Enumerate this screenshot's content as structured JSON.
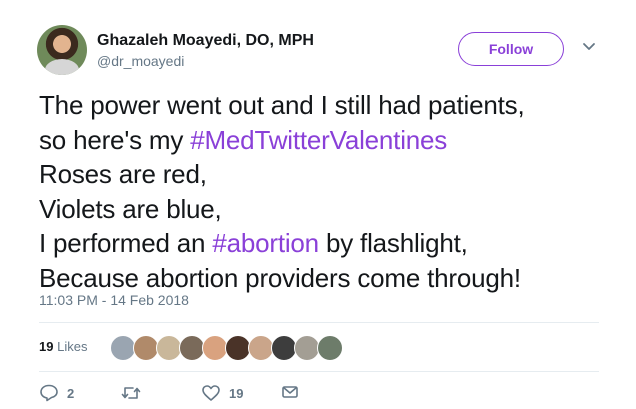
{
  "author": {
    "display_name": "Ghazaleh Moayedi, DO, MPH",
    "handle": "@dr_moayedi",
    "avatar_icon": "avatar-photo"
  },
  "follow_label": "Follow",
  "tweet": {
    "lines": [
      {
        "text": "The power went out and I still had patients,"
      },
      {
        "prefix": "so here's my ",
        "hashtag": "#MedTwitterValentines",
        "suffix": ""
      },
      {
        "text": "Roses are red,"
      },
      {
        "text": "Violets are blue,"
      },
      {
        "prefix": "I performed an ",
        "hashtag": "#abortion",
        "suffix": " by flashlight,"
      },
      {
        "text": "Because abortion providers come through!"
      }
    ]
  },
  "timestamp": "11:03 PM - 14 Feb 2018",
  "likes": {
    "count": "19",
    "label": "Likes",
    "liker_colors": [
      "#9aa5b1",
      "#b08a6a",
      "#c9b79a",
      "#7a6a5a",
      "#d9a27f",
      "#4a3328",
      "#caa58a",
      "#3d3d3d",
      "#a39e94",
      "#6d7c6a"
    ]
  },
  "actions": {
    "reply_count": "2",
    "retweet_count": "",
    "like_count": "19"
  },
  "colors": {
    "accent": "#8a40d8",
    "muted": "#657786",
    "text": "#14171a"
  }
}
